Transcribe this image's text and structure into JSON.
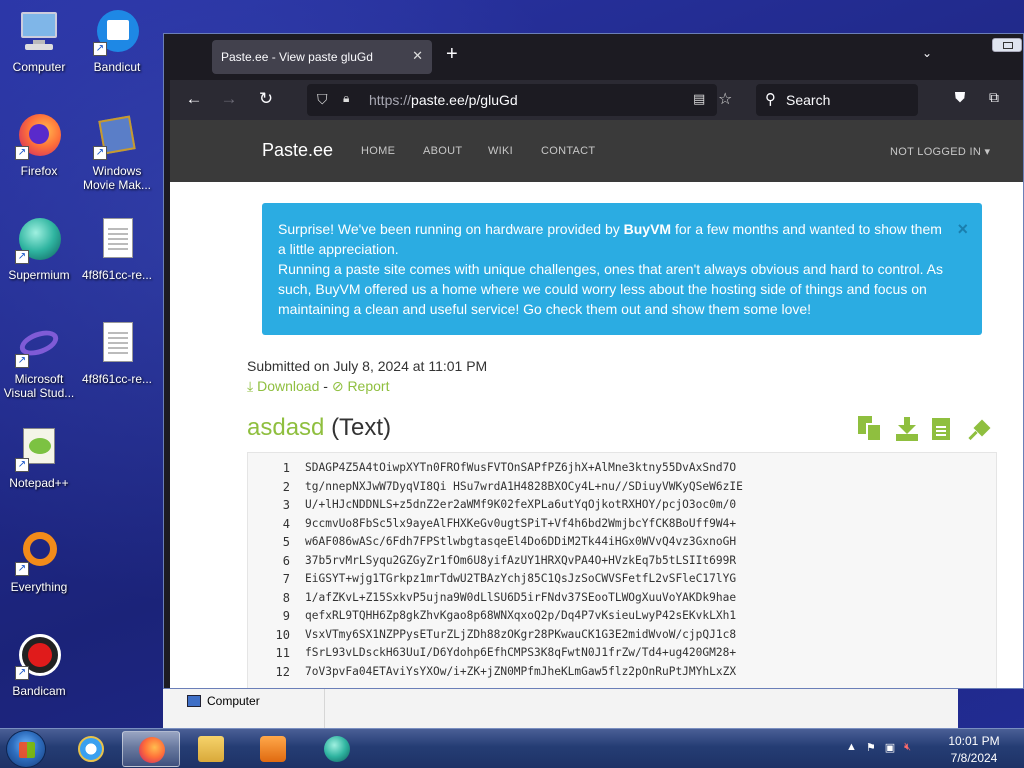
{
  "desktop": {
    "icons": [
      {
        "label": "Computer"
      },
      {
        "label": "Bandicut"
      },
      {
        "label": "Firefox"
      },
      {
        "label": "Windows Movie Mak..."
      },
      {
        "label": "Supermium"
      },
      {
        "label": "4f8f61cc-re..."
      },
      {
        "label": "Microsoft Visual Stud..."
      },
      {
        "label": "4f8f61cc-re..."
      },
      {
        "label": "Notepad++"
      },
      {
        "label": "Everything"
      },
      {
        "label": "Bandicam"
      }
    ]
  },
  "explorer_behind": {
    "item_label": "Computer"
  },
  "browser": {
    "tab_title": "Paste.ee - View paste gluGd",
    "url_proto": "https://",
    "url_rest": "paste.ee/p/gluGd",
    "search_placeholder": "Search"
  },
  "site": {
    "brand": "Paste.ee",
    "menu": [
      "HOME",
      "ABOUT",
      "WIKI",
      "CONTACT"
    ],
    "account": "NOT LOGGED IN",
    "alert": {
      "line1_pre": "Surprise! We've been running on hardware provided by ",
      "line1_bold": "BuyVM",
      "line1_post": " for a few months and wanted to show them a little appreciation.",
      "line2": "Running a paste site comes with unique challenges, ones that aren't always obvious and hard to control. As such, BuyVM offered us a home where we could worry less about the hosting side of things and focus on maintaining a clean and useful service! Go check them out and show them some love!"
    },
    "submitted": "Submitted on July 8, 2024 at 11:01 PM",
    "download_label": "Download",
    "report_label": "Report",
    "paste_name": "asdasd",
    "paste_type": "(Text)",
    "code_lines": [
      {
        "n": "1",
        "t": "SDAGP4Z5A4tOiwpXYTn0FROfWusFVTOnSAPfPZ6jhX+AlMne3ktny55DvAxSnd7O"
      },
      {
        "n": "2",
        "t": "tg/nnepNXJwW7DyqVI8Qi HSu7wrdA1H4828BXOCy4L+nu//SDiuyVWKyQSeW6zIE"
      },
      {
        "n": "3",
        "t": "U/+lHJcNDDNLS+z5dnZ2er2aWMf9K02feXPLa6utYqOjkotRXHOY/pcjO3oc0m/0"
      },
      {
        "n": "4",
        "t": "9ccmvUo8FbSc5lx9ayeAlFHXKeGv0ugtSPiT+Vf4h6bd2WmjbcYfCK8BoUff9W4+"
      },
      {
        "n": "5",
        "t": "w6AF086wASc/6Fdh7FPStlwbgtasqeEl4Do6DDiM2Tk44iHGx0WVvQ4vz3GxnoGH"
      },
      {
        "n": "6",
        "t": "37b5rvMrLSyqu2GZGyZr1fOm6U8yifAzUY1HRXQvPA4O+HVzkEq7b5tLSIIt699R"
      },
      {
        "n": "7",
        "t": "EiGSYT+wjg1TGrkpz1mrTdwU2TBAzYchj85C1QsJzSoCWVSFetfL2vSFleC17lYG"
      },
      {
        "n": "8",
        "t": "1/afZKvL+Z15SxkvP5ujna9W0dLlSU6D5irFNdv37SEooTLWOgXuuVoYAKDk9hae"
      },
      {
        "n": "9",
        "t": "qefxRL9TQHH6Zp8gkZhvKgao8p68WNXqxoQ2p/Dq4P7vKsieuLwyP42sEKvkLXh1"
      },
      {
        "n": "10",
        "t": "VsxVTmy6SX1NZPPysETurZLjZDh88zOKgr28PKwauCK1G3E2midWvoW/cjpQJ1c8"
      },
      {
        "n": "11",
        "t": "fSrL93vLDsckH63UuI/D6Ydohp6EfhCMPS3K8qFwtN0J1frZw/Td4+ug420GM28+"
      },
      {
        "n": "12",
        "t": "7oV3pvFa04ETAviYsYXOw/i+ZK+jZN0MPfmJheKLmGaw5flz2pOnRuPtJMYhLxZX"
      }
    ]
  },
  "taskbar": {
    "time": "10:01 PM",
    "date": "7/8/2024"
  },
  "colors": {
    "accent_green": "#8fbf3f",
    "alert_blue": "#2bace2",
    "site_nav": "#3a3a3a"
  }
}
